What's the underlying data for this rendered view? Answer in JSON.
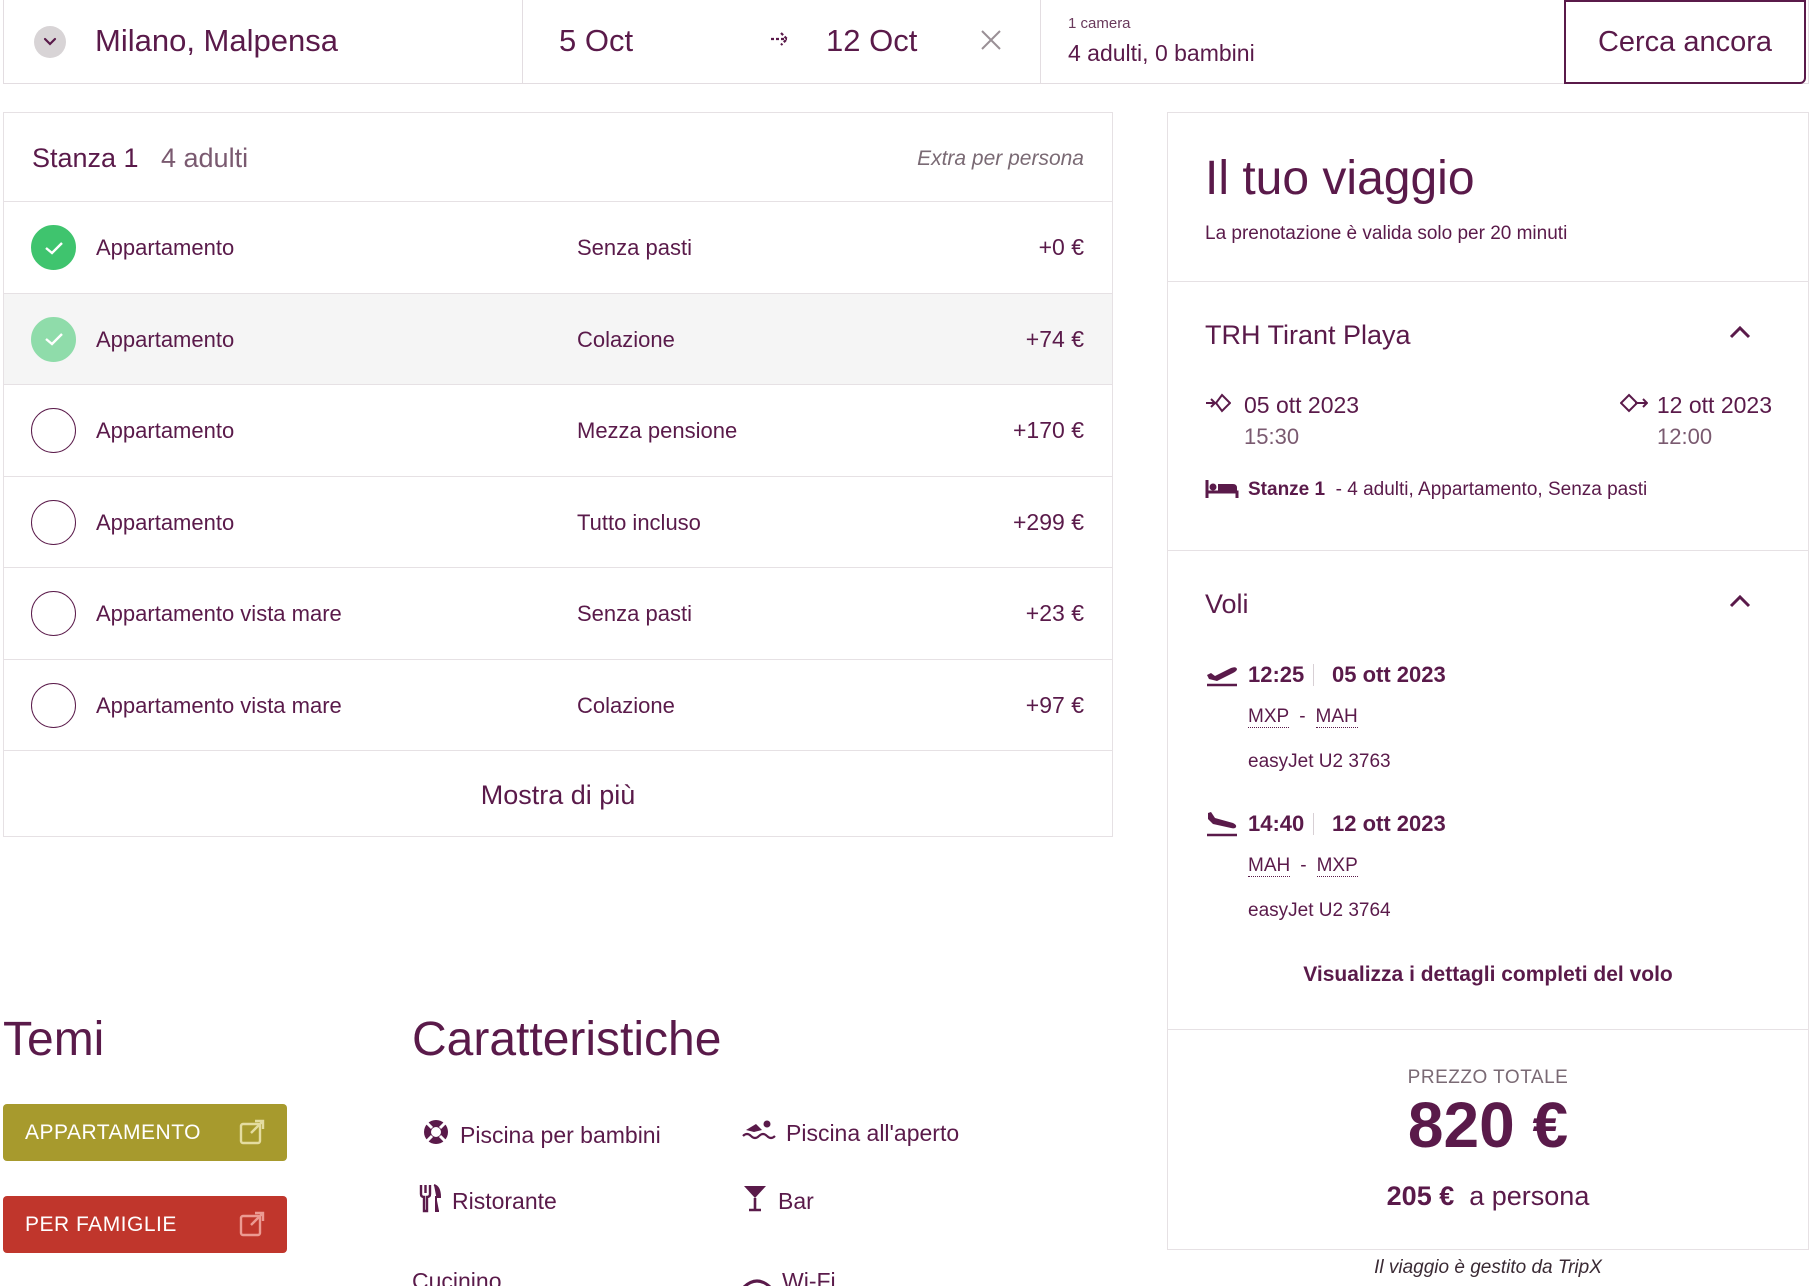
{
  "search": {
    "origin": "Milano, Malpensa",
    "date_out": "5 Oct",
    "date_in": "12 Oct",
    "rooms": "1 camera",
    "guests": "4 adulti, 0 bambini",
    "button": "Cerca ancora"
  },
  "room_options": {
    "title": "Stanza 1",
    "subtitle": "4 adulti",
    "extra_label": "Extra per persona",
    "rows": [
      {
        "room": "Appartamento",
        "board": "Senza pasti",
        "price": "+0 €",
        "state": "selected"
      },
      {
        "room": "Appartamento",
        "board": "Colazione",
        "price": "+74 €",
        "state": "hover"
      },
      {
        "room": "Appartamento",
        "board": "Mezza pensione",
        "price": "+170 €",
        "state": "none"
      },
      {
        "room": "Appartamento",
        "board": "Tutto incluso",
        "price": "+299 €",
        "state": "none"
      },
      {
        "room": "Appartamento vista mare",
        "board": "Senza pasti",
        "price": "+23 €",
        "state": "none"
      },
      {
        "room": "Appartamento vista mare",
        "board": "Colazione",
        "price": "+97 €",
        "state": "none"
      }
    ],
    "show_more": "Mostra di più"
  },
  "themes": {
    "title": "Temi",
    "items": [
      "APPARTAMENTO",
      "PER FAMIGLIE"
    ],
    "colors": [
      "#a79a2d",
      "#c0362c"
    ]
  },
  "features": {
    "title": "Caratteristiche",
    "items": [
      "Piscina per bambini",
      "Piscina all'aperto",
      "Ristorante",
      "Bar",
      "Cucinino",
      "Wi-Fi"
    ]
  },
  "trip": {
    "title": "Il tuo viaggio",
    "note": "La prenotazione è valida solo per 20 minuti",
    "hotel": {
      "name": "TRH Tirant Playa",
      "checkin_date": "05 ott 2023",
      "checkin_time": "15:30",
      "checkout_date": "12 ott 2023",
      "checkout_time": "12:00",
      "room_label": "Stanze 1",
      "room_detail": "- 4 adulti, Appartamento, Senza pasti"
    },
    "flights": {
      "title": "Voli",
      "legs": [
        {
          "time": "12:25",
          "date": "05 ott 2023",
          "from": "MXP",
          "to": "MAH",
          "carrier": "easyJet U2 3763"
        },
        {
          "time": "14:40",
          "date": "12 ott 2023",
          "from": "MAH",
          "to": "MXP",
          "carrier": "easyJet U2 3764"
        }
      ],
      "details_link": "Visualizza i dettagli completi del volo"
    },
    "price": {
      "label": "PREZZO TOTALE",
      "total": "820 €",
      "per_person_value": "205 €",
      "per_person_label": "a persona"
    },
    "managed_by": "Il viaggio è gestito da TripX"
  },
  "colors": {
    "brand": "#5a1a4a",
    "selected": "#3fc46e"
  }
}
